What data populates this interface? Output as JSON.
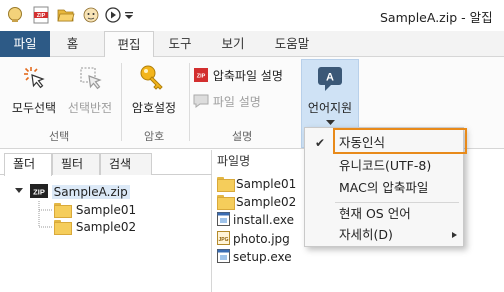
{
  "window": {
    "title": "SampleA.zip - 알집",
    "quick_access_icons": [
      "app-logo-icon",
      "zip-file-icon",
      "open-folder-icon",
      "bandizip-mascot-icon",
      "play-circle-icon",
      "customize-arrow-icon"
    ]
  },
  "ribbon_tabs": [
    "파일",
    "홈",
    "편집",
    "도구",
    "보기",
    "도움말"
  ],
  "active_tab": "편집",
  "ribbon": {
    "select_all_label": "모두선택",
    "invert_selection_label": "선택반전",
    "selection_group": "선택",
    "set_password_label": "암호설정",
    "password_group": "암호",
    "archive_desc_label": "압축파일 설명",
    "file_desc_label": "파일 설명",
    "description_group": "설명",
    "language_label": "언어지원"
  },
  "left_panel": {
    "tabs": [
      "폴더",
      "필터",
      "검색"
    ],
    "tree": {
      "root": "SampleA.zip",
      "children": [
        "Sample01",
        "Sample02"
      ]
    }
  },
  "file_list": {
    "column_name": "파일명",
    "items": [
      {
        "name": "Sample01",
        "icon": "folder-icon"
      },
      {
        "name": "Sample02",
        "icon": "folder-icon"
      },
      {
        "name": "install.exe",
        "icon": "exe-icon"
      },
      {
        "name": "photo.jpg",
        "icon": "jpg-icon"
      },
      {
        "name": "setup.exe",
        "icon": "exe-icon"
      }
    ]
  },
  "language_menu": {
    "items": [
      "자동인식",
      "유니코드(UTF-8)",
      "MAC의 압축파일",
      "현재 OS 언어",
      "자세히(D)"
    ],
    "checked": "자동인식",
    "highlight_color": "#e88a1a"
  },
  "colors": {
    "file_tab_bg": "#2d5a86",
    "language_button_bg": "#cfe2f5",
    "folder_yellow": "#f5cd5b"
  }
}
